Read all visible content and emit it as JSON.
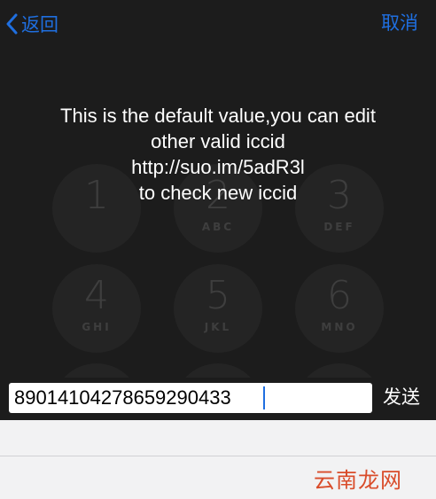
{
  "nav": {
    "back_label": "返回",
    "cancel_label": "取消"
  },
  "message": {
    "lines": [
      "This is the default value,you can edit",
      "other valid iccid",
      "http://suo.im/5adR3l",
      "to check new iccid"
    ]
  },
  "keypad": {
    "keys": [
      {
        "digit": "1",
        "letters": ""
      },
      {
        "digit": "2",
        "letters": "ABC"
      },
      {
        "digit": "3",
        "letters": "DEF"
      },
      {
        "digit": "4",
        "letters": "GHI"
      },
      {
        "digit": "5",
        "letters": "JKL"
      },
      {
        "digit": "6",
        "letters": "MNO"
      }
    ]
  },
  "input": {
    "value": "89014104278659290433"
  },
  "send_label": "发送",
  "watermark": "云南龙网",
  "colors": {
    "accent": "#1f6fe0",
    "background": "#1c1c1c",
    "bottom": "#f2f2f3"
  }
}
